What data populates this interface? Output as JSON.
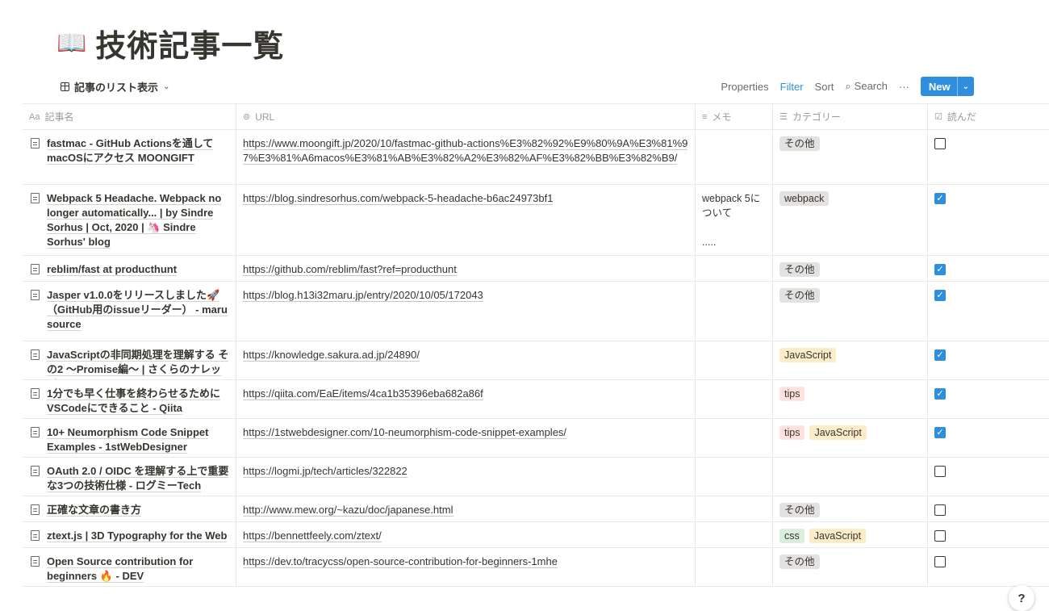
{
  "page": {
    "icon": "📖",
    "title": "技術記事一覧"
  },
  "view": {
    "name": "記事のリスト表示",
    "tools": {
      "properties": "Properties",
      "filter": "Filter",
      "sort": "Sort",
      "search": "Search",
      "more": "···",
      "new": "New"
    }
  },
  "columns": [
    {
      "icon": "Aa",
      "label": "記事名"
    },
    {
      "icon": "⊚",
      "label": "URL"
    },
    {
      "icon": "≡",
      "label": "メモ"
    },
    {
      "icon": "☰",
      "label": "カテゴリー"
    },
    {
      "icon": "☑",
      "label": "読んだ"
    }
  ],
  "rows": [
    {
      "name": "fastmac - GitHub Actionsを通して macOSにアクセス MOONGIFT",
      "url": "https://www.moongift.jp/2020/10/fastmac-github-actions%E3%82%92%E9%80%9A%E3%81%97%E3%81%A6macos%E3%81%AB%E3%82%A2%E3%82%AF%E3%82%BB%E3%82%B9/",
      "memo": "",
      "tags": [
        {
          "label": "その他",
          "color": "gray"
        }
      ],
      "read": false
    },
    {
      "name": "Webpack 5 Headache. Webpack no longer automatically... | by Sindre Sorhus | Oct, 2020 | 🦄 Sindre Sorhus' blog",
      "url": "https://blog.sindresorhus.com/webpack-5-headache-b6ac24973bf1",
      "memo": "webpack 5について\n\n.....",
      "tags": [
        {
          "label": "webpack",
          "color": "gray"
        }
      ],
      "read": true
    },
    {
      "name": "reblim/fast at producthunt",
      "url": "https://github.com/reblim/fast?ref=producthunt",
      "memo": "",
      "tags": [
        {
          "label": "その他",
          "color": "gray"
        }
      ],
      "read": true
    },
    {
      "name": "Jasper v1.0.0をリリースしました🚀（GitHub用のissueリーダー） - maru source",
      "url": "https://blog.h13i32maru.jp/entry/2020/10/05/172043",
      "memo": "",
      "tags": [
        {
          "label": "その他",
          "color": "gray"
        }
      ],
      "read": true
    },
    {
      "name": "JavaScriptの非同期処理を理解する その2 〜Promise編〜 | さくらのナレッジ",
      "url": "https://knowledge.sakura.ad.jp/24890/",
      "memo": "",
      "tags": [
        {
          "label": "JavaScript",
          "color": "orange"
        }
      ],
      "read": true
    },
    {
      "name": "1分でも早く仕事を終わらせるために VSCodeにできること - Qiita",
      "url": "https://qiita.com/EaE/items/4ca1b35396eba682a86f",
      "memo": "",
      "tags": [
        {
          "label": "tips",
          "color": "red"
        }
      ],
      "read": true
    },
    {
      "name": "10+ Neumorphism Code Snippet Examples - 1stWebDesigner",
      "url": "https://1stwebdesigner.com/10-neumorphism-code-snippet-examples/",
      "memo": "",
      "tags": [
        {
          "label": "tips",
          "color": "red"
        },
        {
          "label": "JavaScript",
          "color": "orange"
        }
      ],
      "read": true
    },
    {
      "name": "OAuth 2.0 / OIDC を理解する上で重要な3つの技術仕様 - ログミーTech",
      "url": "https://logmi.jp/tech/articles/322822",
      "memo": "",
      "tags": [],
      "read": false
    },
    {
      "name": "正確な文章の書き方",
      "url": "http://www.mew.org/~kazu/doc/japanese.html",
      "memo": "",
      "tags": [
        {
          "label": "その他",
          "color": "gray"
        }
      ],
      "read": false
    },
    {
      "name": "ztext.js | 3D Typography for the Web",
      "url": "https://bennettfeely.com/ztext/",
      "memo": "",
      "tags": [
        {
          "label": "css",
          "color": "green"
        },
        {
          "label": "JavaScript",
          "color": "orange"
        }
      ],
      "read": false
    },
    {
      "name": "Open Source contribution for beginners 🔥 - DEV",
      "url": "https://dev.to/tracycss/open-source-contribution-for-beginners-1mhe",
      "memo": "",
      "tags": [
        {
          "label": "その他",
          "color": "gray"
        }
      ],
      "read": false
    }
  ],
  "help": "?"
}
